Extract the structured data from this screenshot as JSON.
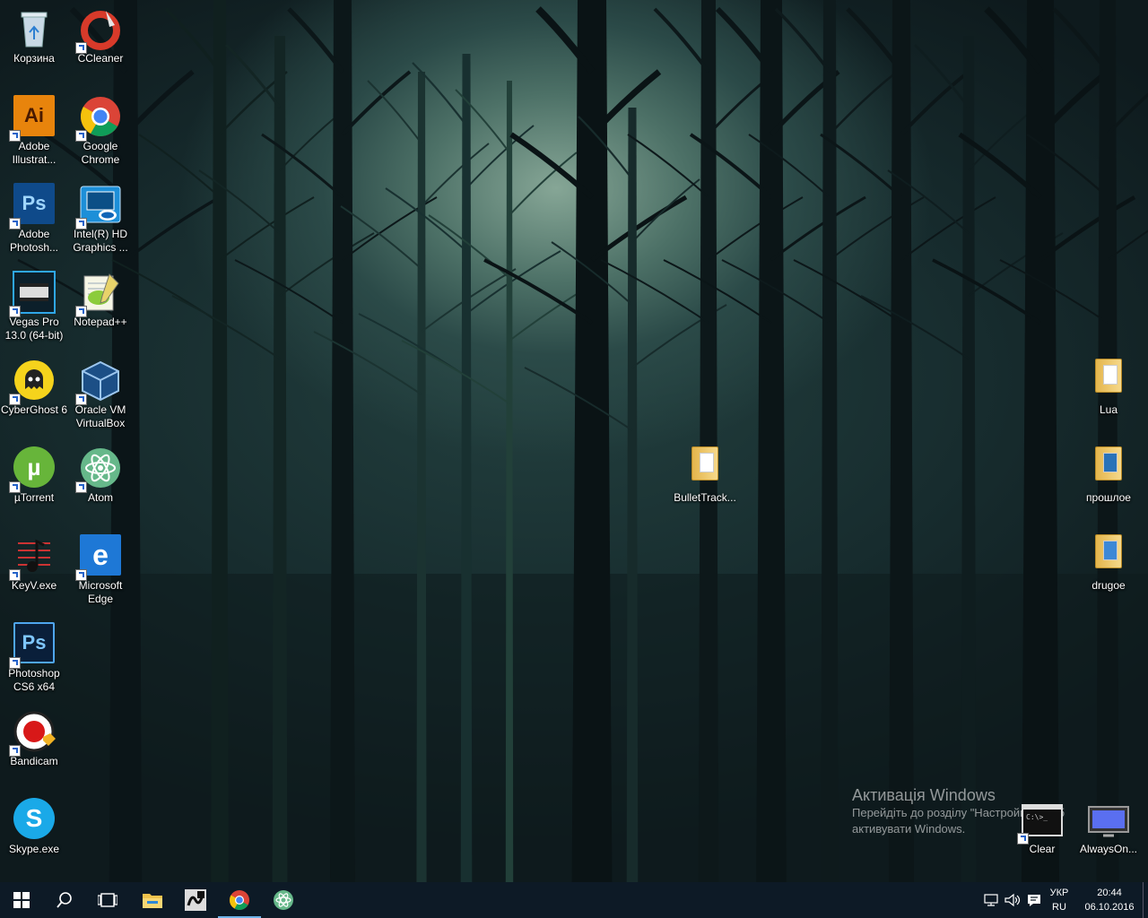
{
  "desktop": {
    "icons_left": [
      {
        "label": "Корзина",
        "icon": "recycle-bin-icon",
        "shortcut": false
      },
      {
        "label": "CCleaner",
        "icon": "ccleaner-icon",
        "shortcut": true
      },
      {
        "label": "Adobe Illustrat...",
        "icon": "adobe-illustrator-icon",
        "shortcut": true
      },
      {
        "label": "Google Chrome",
        "icon": "google-chrome-icon",
        "shortcut": true
      },
      {
        "label": "Adobe Photosh...",
        "icon": "adobe-photoshop-icon",
        "shortcut": true
      },
      {
        "label": "Intel(R) HD Graphics ...",
        "icon": "intel-graphics-icon",
        "shortcut": true
      },
      {
        "label": "Vegas Pro 13.0 (64-bit)",
        "icon": "vegas-pro-icon",
        "shortcut": true
      },
      {
        "label": "Notepad++",
        "icon": "notepad-plus-plus-icon",
        "shortcut": true
      },
      {
        "label": "CyberGhost 6",
        "icon": "cyberghost-icon",
        "shortcut": true
      },
      {
        "label": "Oracle VM VirtualBox",
        "icon": "virtualbox-icon",
        "shortcut": true
      },
      {
        "label": "µTorrent",
        "icon": "utorrent-icon",
        "shortcut": true
      },
      {
        "label": "Atom",
        "icon": "atom-icon",
        "shortcut": true
      },
      {
        "label": "KeyV.exe",
        "icon": "keyv-icon",
        "shortcut": true
      },
      {
        "label": "Microsoft Edge",
        "icon": "microsoft-edge-icon",
        "shortcut": true
      },
      {
        "label": "Photoshop CS6 x64",
        "icon": "photoshop-cs6-icon",
        "shortcut": true
      },
      {
        "label": "Bandicam",
        "icon": "bandicam-icon",
        "shortcut": true
      },
      {
        "label": "Skype.exe",
        "icon": "skype-icon",
        "shortcut": true
      }
    ],
    "icons_other": [
      {
        "label": "BulletTrack...",
        "icon": "folder-icon"
      },
      {
        "label": "Lua",
        "icon": "folder-icon"
      },
      {
        "label": "прошлое",
        "icon": "folder-icon"
      },
      {
        "label": "drugoe",
        "icon": "folder-icon"
      },
      {
        "label": "Clear",
        "icon": "cmd-window-icon"
      },
      {
        "label": "AlwaysOn...",
        "icon": "monitor-icon"
      }
    ]
  },
  "activation": {
    "title": "Активація Windows",
    "line1": "Перейдіть до розділу \"Настройки\", щоб",
    "line2": "активувати Windows."
  },
  "taskbar": {
    "buttons": [
      "start-windows-icon",
      "search-icon",
      "task-view-icon",
      "file-explorer-icon",
      "app-icon",
      "google-chrome-icon",
      "atom-icon"
    ],
    "lang_top": "УКР",
    "lang_bottom": "RU",
    "time": "20:44",
    "date": "06.10.2016"
  }
}
